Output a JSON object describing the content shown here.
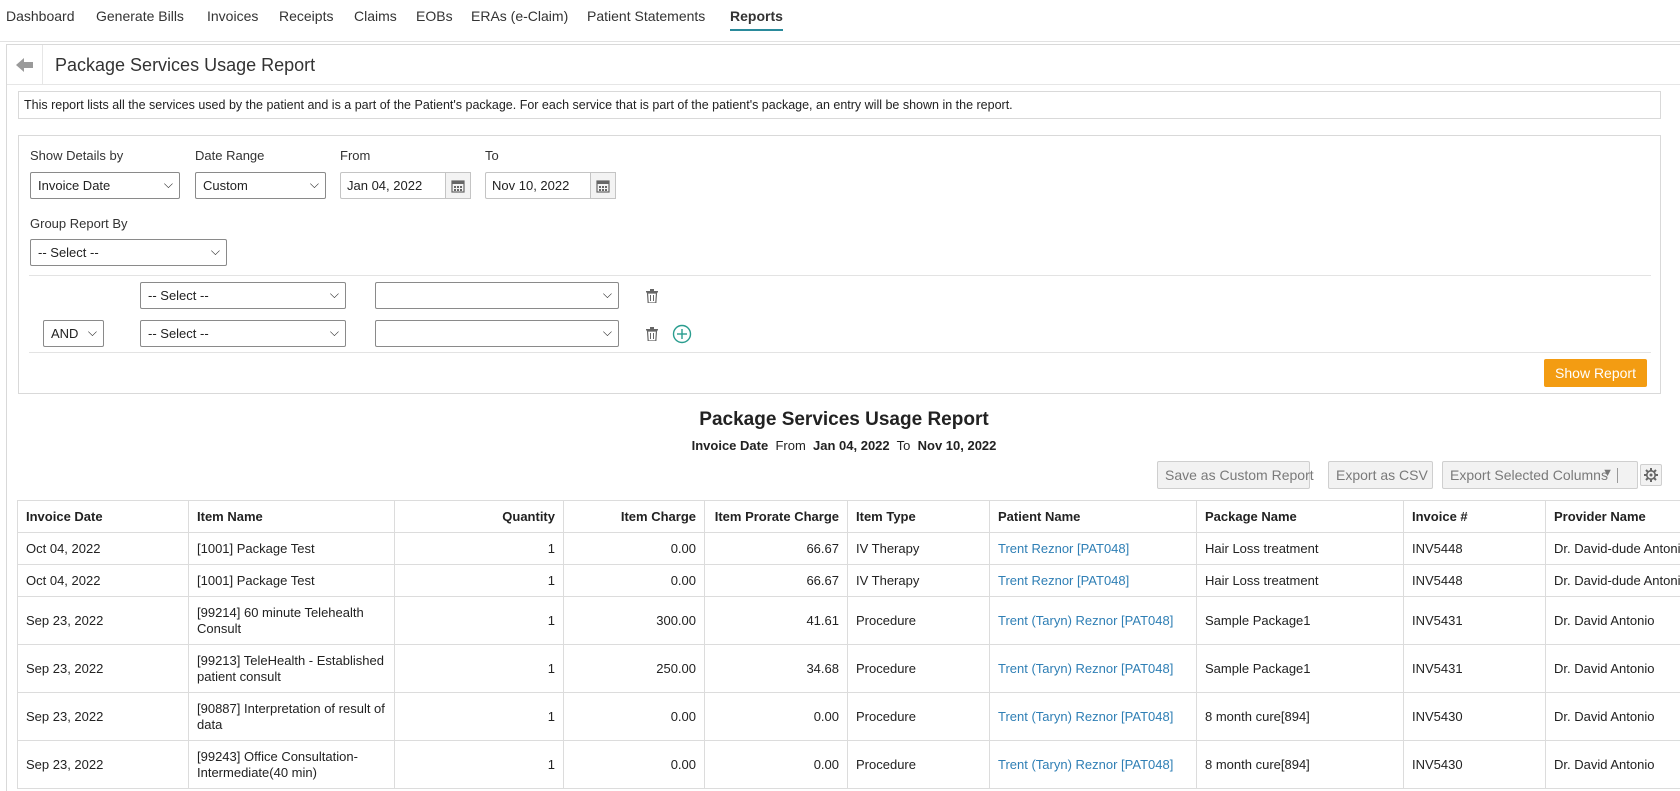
{
  "nav": {
    "tabs": [
      {
        "label": "Dashboard"
      },
      {
        "label": "Generate Bills"
      },
      {
        "label": "Invoices"
      },
      {
        "label": "Receipts"
      },
      {
        "label": "Claims"
      },
      {
        "label": "EOBs"
      },
      {
        "label": "ERAs (e-Claim)"
      },
      {
        "label": "Patient Statements"
      },
      {
        "label": "Reports"
      }
    ],
    "active": "Reports"
  },
  "page": {
    "title": "Package Services Usage Report",
    "description": "This report lists all the services used by the patient and is a part of the Patient's package. For each service that is part of the patient's package, an entry will be shown in the report."
  },
  "filters": {
    "show_details_by": {
      "label": "Show Details by",
      "value": "Invoice Date"
    },
    "date_range": {
      "label": "Date Range",
      "value": "Custom"
    },
    "from": {
      "label": "From",
      "value": "Jan 04, 2022"
    },
    "to": {
      "label": "To",
      "value": "Nov 10, 2022"
    },
    "group_by": {
      "label": "Group Report By",
      "value": "-- Select --"
    },
    "conditions": [
      {
        "operator": "",
        "field": "-- Select --",
        "value": ""
      },
      {
        "operator": "AND",
        "field": "-- Select --",
        "value": ""
      }
    ],
    "show_report_label": "Show Report"
  },
  "report": {
    "title": "Package Services Usage Report",
    "sub_field": "Invoice Date",
    "sub_from_label": "From",
    "sub_from": "Jan 04, 2022",
    "sub_to_label": "To",
    "sub_to": "Nov 10, 2022",
    "save_custom_label": "Save as Custom Report",
    "export_csv_label": "Export as CSV",
    "export_selected_label": "Export Selected Columns"
  },
  "table": {
    "columns": [
      "Invoice Date",
      "Item Name",
      "Quantity",
      "Item Charge",
      "Item Prorate Charge",
      "Item Type",
      "Patient Name",
      "Package Name",
      "Invoice #",
      "Provider Name"
    ],
    "rows": [
      {
        "invoice_date": "Oct 04, 2022",
        "item_name": "[1001] Package Test",
        "quantity": "1",
        "item_charge": "0.00",
        "prorate": "66.67",
        "item_type": "IV Therapy",
        "patient": "Trent Reznor [PAT048]",
        "package": "Hair Loss treatment",
        "invoice": "INV5448",
        "provider": "Dr. David-dude Antonio"
      },
      {
        "invoice_date": "Oct 04, 2022",
        "item_name": "[1001] Package Test",
        "quantity": "1",
        "item_charge": "0.00",
        "prorate": "66.67",
        "item_type": "IV Therapy",
        "patient": "Trent Reznor [PAT048]",
        "package": "Hair Loss treatment",
        "invoice": "INV5448",
        "provider": "Dr. David-dude Antonio"
      },
      {
        "invoice_date": "Sep 23, 2022",
        "item_name": "[99214] 60 minute Telehealth Consult",
        "quantity": "1",
        "item_charge": "300.00",
        "prorate": "41.61",
        "item_type": "Procedure",
        "patient": "Trent (Taryn) Reznor [PAT048]",
        "package": "Sample Package1",
        "invoice": "INV5431",
        "provider": "Dr. David Antonio"
      },
      {
        "invoice_date": "Sep 23, 2022",
        "item_name": "[99213] TeleHealth - Established patient consult",
        "quantity": "1",
        "item_charge": "250.00",
        "prorate": "34.68",
        "item_type": "Procedure",
        "patient": "Trent (Taryn) Reznor [PAT048]",
        "package": "Sample Package1",
        "invoice": "INV5431",
        "provider": "Dr. David Antonio"
      },
      {
        "invoice_date": "Sep 23, 2022",
        "item_name": "[90887] Interpretation of result of data",
        "quantity": "1",
        "item_charge": "0.00",
        "prorate": "0.00",
        "item_type": "Procedure",
        "patient": "Trent (Taryn) Reznor [PAT048]",
        "package": "8 month cure[894]",
        "invoice": "INV5430",
        "provider": "Dr. David Antonio"
      },
      {
        "invoice_date": "Sep 23, 2022",
        "item_name": "[99243] Office Consultation- Intermediate(40 min)",
        "quantity": "1",
        "item_charge": "0.00",
        "prorate": "0.00",
        "item_type": "Procedure",
        "patient": "Trent (Taryn) Reznor [PAT048]",
        "package": "8 month cure[894]",
        "invoice": "INV5430",
        "provider": "Dr. David Antonio"
      }
    ]
  },
  "colors": {
    "accent": "#2a8a9b",
    "button_orange": "#f39c12",
    "link": "#2f7fb5"
  }
}
